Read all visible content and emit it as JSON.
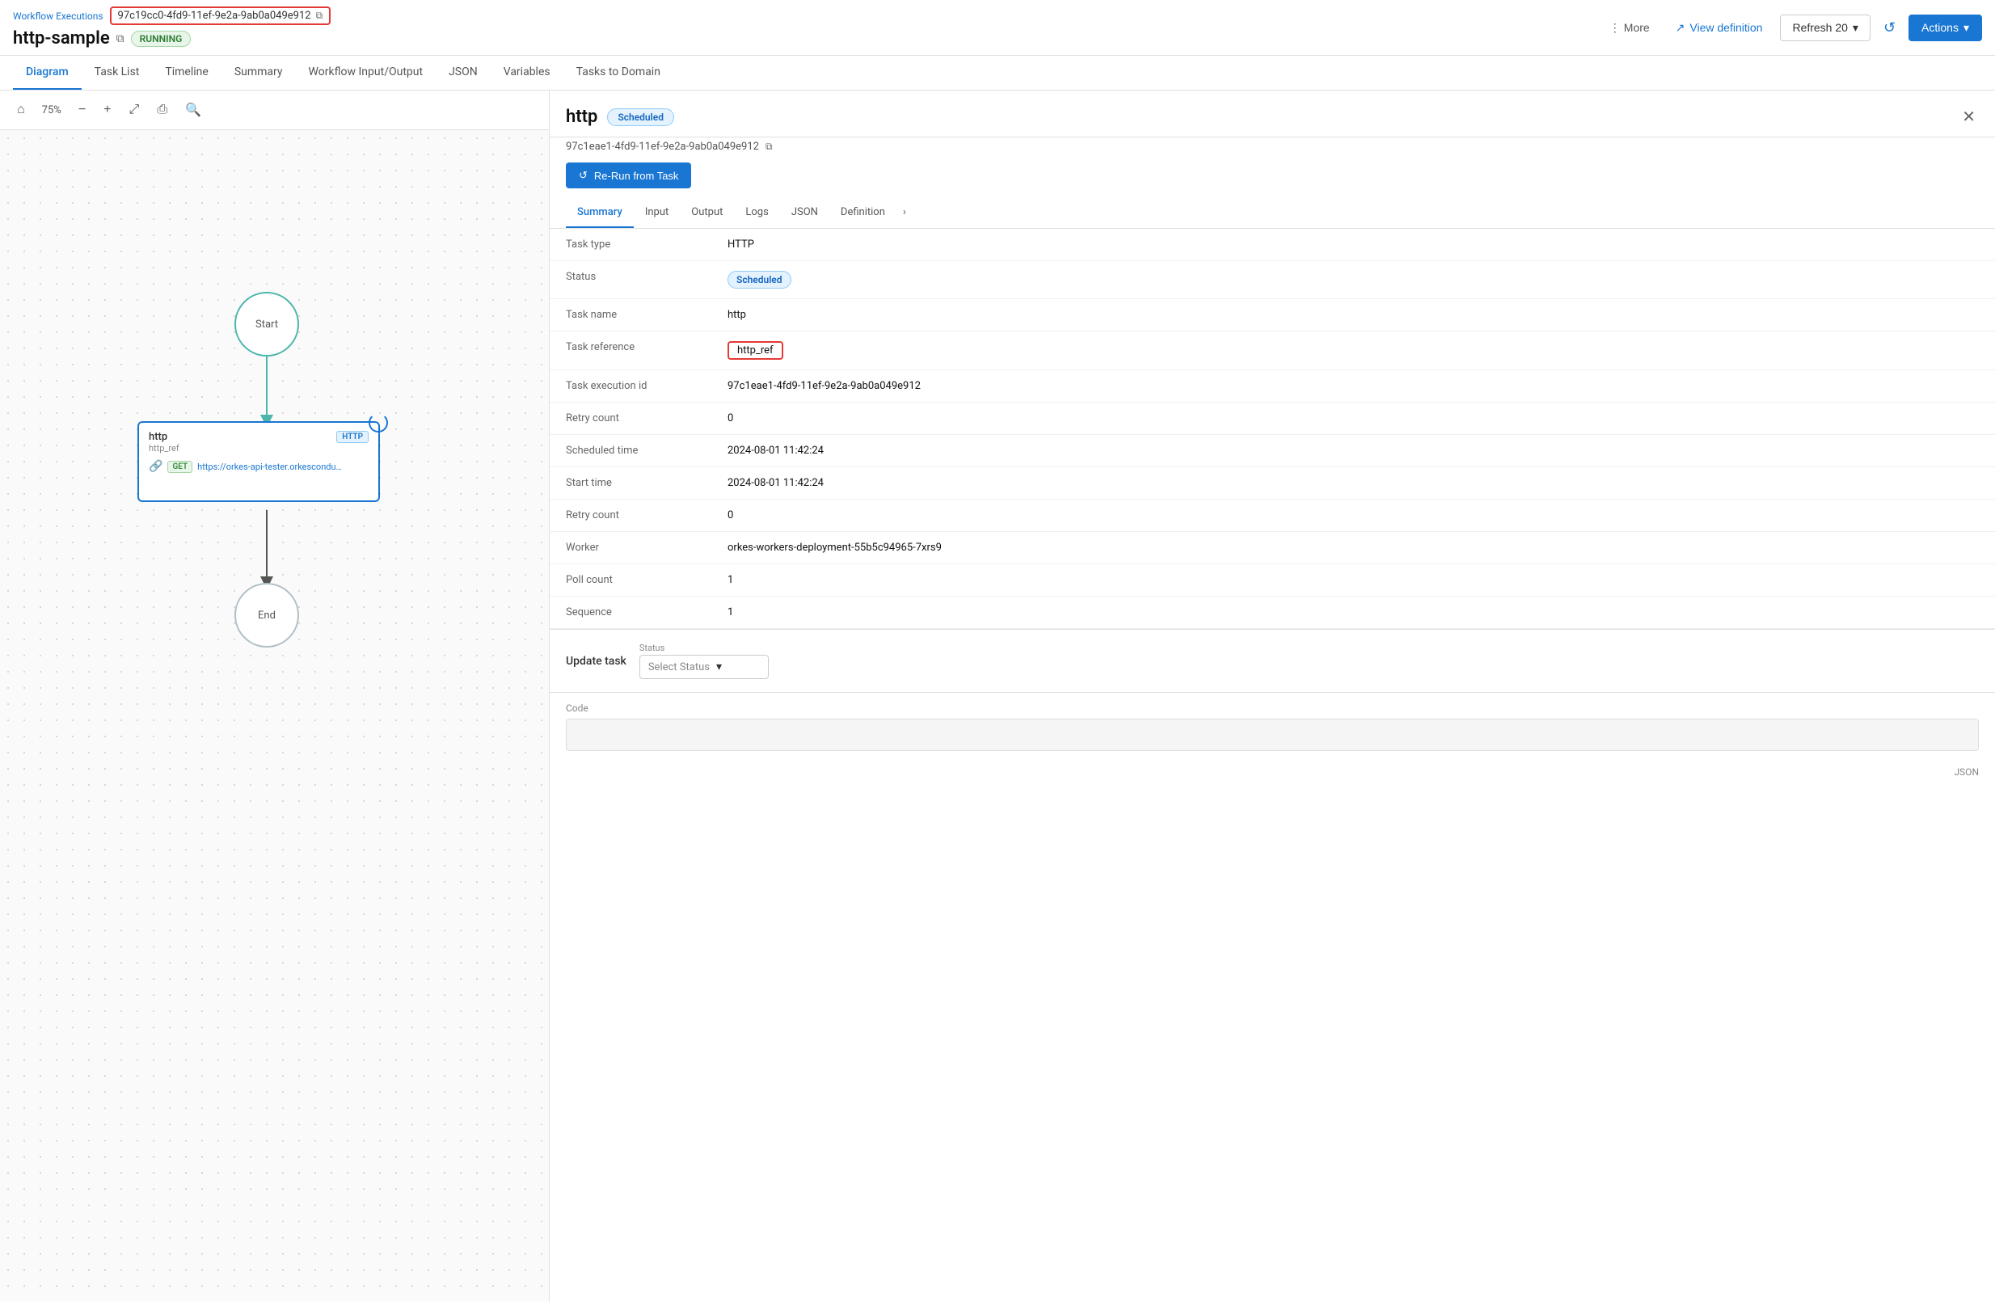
{
  "header": {
    "breadcrumb": "Workflow Executions",
    "workflow_id": "97c19cc0-4fd9-11ef-9e2a-9ab0a049e912",
    "workflow_name": "http-sample",
    "workflow_status": "RUNNING",
    "btn_more": "More",
    "btn_view_def": "View definition",
    "btn_refresh": "Refresh 20",
    "btn_actions": "Actions"
  },
  "tabs": [
    {
      "label": "Diagram",
      "active": true
    },
    {
      "label": "Task List",
      "active": false
    },
    {
      "label": "Timeline",
      "active": false
    },
    {
      "label": "Summary",
      "active": false
    },
    {
      "label": "Workflow Input/Output",
      "active": false
    },
    {
      "label": "JSON",
      "active": false
    },
    {
      "label": "Variables",
      "active": false
    },
    {
      "label": "Tasks to Domain",
      "active": false
    }
  ],
  "diagram": {
    "zoom": "75%",
    "nodes": {
      "start": "Start",
      "http_name": "http",
      "http_ref": "http_ref",
      "http_badge": "HTTP",
      "get_badge": "GET",
      "url": "https://orkes-api-tester.orkesconduc...",
      "end": "End"
    }
  },
  "right_panel": {
    "task_name": "http",
    "task_status_badge": "Scheduled",
    "task_exec_id": "97c1eae1-4fd9-11ef-9e2a-9ab0a049e912",
    "rerun_btn": "Re-Run from Task",
    "detail_tabs": [
      {
        "label": "Summary",
        "active": true
      },
      {
        "label": "Input",
        "active": false
      },
      {
        "label": "Output",
        "active": false
      },
      {
        "label": "Logs",
        "active": false
      },
      {
        "label": "JSON",
        "active": false
      },
      {
        "label": "Definition",
        "active": false
      }
    ],
    "summary": {
      "rows": [
        {
          "label": "Task type",
          "value": "HTTP"
        },
        {
          "label": "Status",
          "value": "Scheduled",
          "type": "badge"
        },
        {
          "label": "Task name",
          "value": "http"
        },
        {
          "label": "Task reference",
          "value": "http_ref",
          "type": "ref-box"
        },
        {
          "label": "Task execution id",
          "value": "97c1eae1-4fd9-11ef-9e2a-9ab0a049e912"
        },
        {
          "label": "Retry count",
          "value": "0"
        },
        {
          "label": "Scheduled time",
          "value": "2024-08-01 11:42:24"
        },
        {
          "label": "Start time",
          "value": "2024-08-01 11:42:24"
        },
        {
          "label": "Retry count",
          "value": "0"
        },
        {
          "label": "Worker",
          "value": "orkes-workers-deployment-55b5c94965-7xrs9"
        },
        {
          "label": "Poll count",
          "value": "1"
        },
        {
          "label": "Sequence",
          "value": "1"
        }
      ]
    },
    "update_task": {
      "label": "Update task",
      "status_label": "Status",
      "status_placeholder": "Select Status"
    },
    "code_section": {
      "label": "Code",
      "json_label": "JSON"
    }
  }
}
